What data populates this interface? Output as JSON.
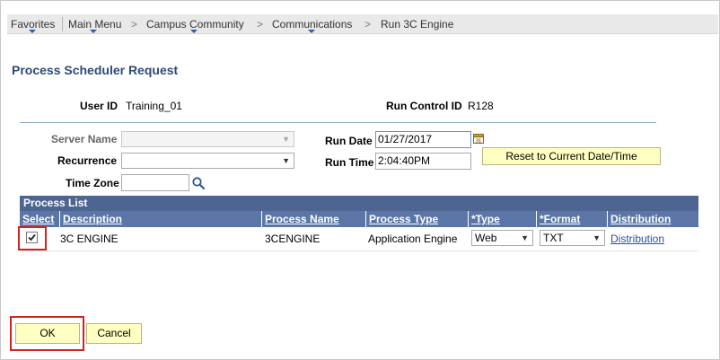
{
  "breadcrumb": {
    "favorites": "Favorites",
    "main_menu": "Main Menu",
    "campus_community": "Campus Community",
    "communications": "Communications",
    "run_3c_engine": "Run 3C Engine",
    "separator": ">"
  },
  "page": {
    "title": "Process Scheduler Request"
  },
  "header": {
    "user_id_label": "User ID",
    "user_id_value": "Training_01",
    "run_control_label": "Run Control ID",
    "run_control_value": "R128"
  },
  "form": {
    "server_name_label": "Server Name",
    "server_name_value": "",
    "recurrence_label": "Recurrence",
    "recurrence_value": "",
    "time_zone_label": "Time Zone",
    "time_zone_value": "",
    "run_date_label": "Run Date",
    "run_date_value": "01/27/2017",
    "run_time_label": "Run Time",
    "run_time_value": "2:04:40PM",
    "reset_button": "Reset to Current Date/Time"
  },
  "process_list": {
    "title": "Process List",
    "columns": [
      "Select",
      "Description",
      "Process Name",
      "Process Type",
      "*Type",
      "*Format",
      "Distribution"
    ],
    "rows": [
      {
        "selected": true,
        "description": "3C ENGINE",
        "process_name": "3CENGINE",
        "process_type": "Application Engine",
        "type": "Web",
        "format": "TXT",
        "distribution": "Distribution"
      }
    ]
  },
  "actions": {
    "ok": "OK",
    "cancel": "Cancel"
  },
  "icons": {
    "dropdown": "▼",
    "calendar": "calendar-icon",
    "lookup": "magnifier-icon"
  },
  "colors": {
    "grid_header": "#5b76a6",
    "grid_title": "#4f6591",
    "page_title": "#2e4a78",
    "button_yellow": "#ffffc2",
    "highlight_red": "#d32222",
    "link": "#2a4fa6"
  }
}
